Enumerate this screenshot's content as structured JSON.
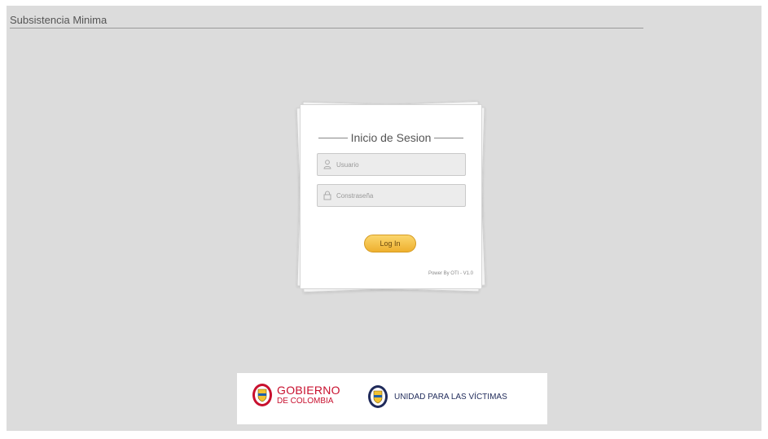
{
  "header": {
    "app_title": "Subsistencia Minima"
  },
  "login": {
    "title": "Inicio de Sesion",
    "username": {
      "placeholder": "Usuario",
      "value": "",
      "icon": "user-icon"
    },
    "password": {
      "placeholder": "Constraseña",
      "value": "",
      "icon": "lock-icon"
    },
    "button_label": "Log In",
    "footer": "Power By OTI - V1.0"
  },
  "logos": {
    "gobierno_line1": "GOBIERNO",
    "gobierno_line2": "DE COLOMBIA",
    "unidad": "UNIDAD PARA LAS VÍCTIMAS"
  },
  "colors": {
    "background": "#dcdcdc",
    "button": "#f2be45",
    "gobierno_red": "#c8102e",
    "unidad_blue": "#1f2a5a"
  }
}
